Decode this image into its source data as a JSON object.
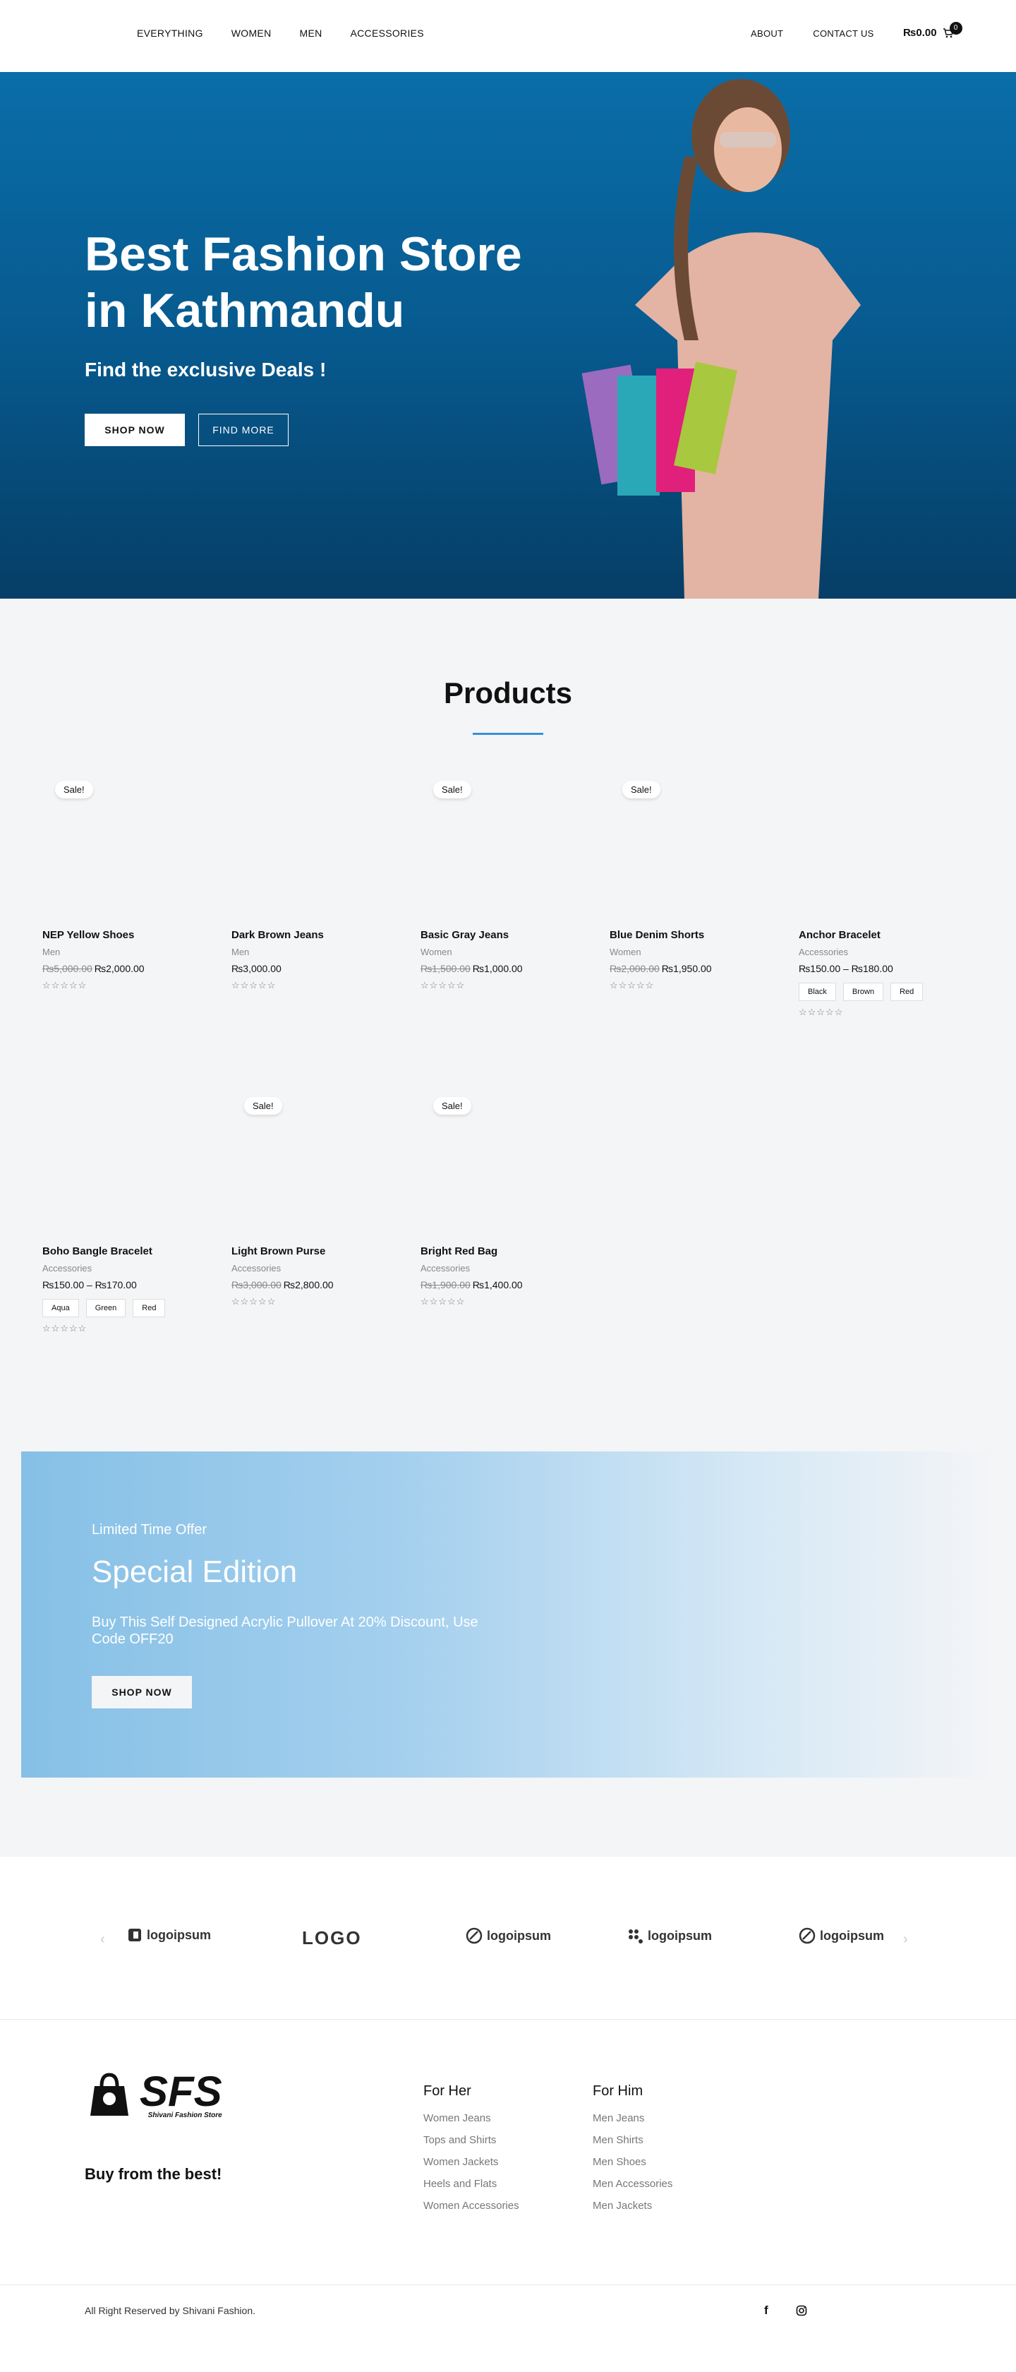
{
  "nav": {
    "left": [
      "EVERYTHING",
      "WOMEN",
      "MEN",
      "ACCESSORIES"
    ],
    "right": [
      "ABOUT",
      "CONTACT US"
    ],
    "cart_total": "₨0.00",
    "cart_count": "0"
  },
  "hero": {
    "title": "Best Fashion Store in Kathmandu",
    "subtitle": "Find the exclusive Deals !",
    "button_primary": "SHOP NOW",
    "button_secondary": "FIND MORE"
  },
  "products": {
    "heading": "Products",
    "sale_badge": "Sale!",
    "rating_stars": "☆☆☆☆☆",
    "items": [
      {
        "name": "NEP Yellow Shoes",
        "category": "Men",
        "old_price": "₨5,000.00",
        "price": "₨2,000.00",
        "sale": true
      },
      {
        "name": "Dark Brown Jeans",
        "category": "Men",
        "old_price": "",
        "price": "₨3,000.00",
        "sale": false
      },
      {
        "name": "Basic Gray Jeans",
        "category": "Women",
        "old_price": "₨1,500.00",
        "price": "₨1,000.00",
        "sale": true
      },
      {
        "name": "Blue Denim Shorts",
        "category": "Women",
        "old_price": "₨2,000.00",
        "price": "₨1,950.00",
        "sale": true
      },
      {
        "name": "Anchor Bracelet",
        "category": "Accessories",
        "old_price": "",
        "price": "₨150.00 – ₨180.00",
        "sale": false,
        "swatches": [
          "Black",
          "Brown",
          "Red"
        ]
      },
      {
        "name": "Boho Bangle Bracelet",
        "category": "Accessories",
        "old_price": "",
        "price": "₨150.00 – ₨170.00",
        "sale": false,
        "swatches": [
          "Aqua",
          "Green",
          "Red"
        ]
      },
      {
        "name": "Light Brown Purse",
        "category": "Accessories",
        "old_price": "₨3,000.00",
        "price": "₨2,800.00",
        "sale": true
      },
      {
        "name": "Bright Red Bag",
        "category": "Accessories",
        "old_price": "₨1,900.00",
        "price": "₨1,400.00",
        "sale": true
      }
    ]
  },
  "promo": {
    "eyebrow": "Limited Time Offer",
    "title": "Special Edition",
    "description": "Buy This Self Designed Acrylic Pullover At 20% Discount, Use Code OFF20",
    "button": "SHOP NOW"
  },
  "partners": [
    "logoipsum",
    "LOGO",
    "logoipsum",
    "logoipsum",
    "logoipsum"
  ],
  "footer": {
    "brand": "SFS",
    "brand_sub": "Shivani Fashion Store",
    "tagline": "Buy from the best!",
    "col_her_title": "For Her",
    "col_her": [
      "Women Jeans",
      "Tops and Shirts",
      "Women Jackets",
      "Heels and Flats",
      "Women Accessories"
    ],
    "col_him_title": "For Him",
    "col_him": [
      "Men Jeans",
      "Men Shirts",
      "Men Shoes",
      "Men Accessories",
      "Men Jackets"
    ],
    "copyright": "All Right Reserved by Shivani Fashion.",
    "social_facebook": "f"
  },
  "colors": {
    "hero_blue": "#0a6ea8",
    "accent": "#3a8fd8",
    "promo_blue": "#86c0e6"
  }
}
